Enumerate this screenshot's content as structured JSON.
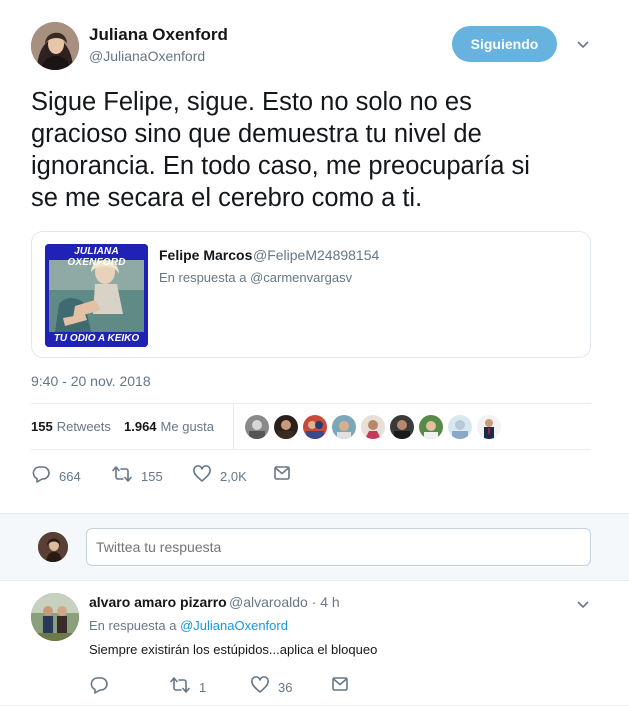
{
  "tweet": {
    "author_name": "Juliana Oxenford",
    "author_handle": "@JulianaOxenford",
    "follow_label": "Siguiendo",
    "text": "Sigue Felipe, sigue. Esto no solo no es\ngracioso sino que demuestra tu nivel de\nignorancia. En todo caso, me preocuparía si\nse me secara el cerebro como a ti.",
    "timestamp": "9:40 - 20 nov. 2018",
    "quote": {
      "image_top_text": "JULIANA OXENFORD",
      "image_bottom_text": "TU ODIO A KEIKO",
      "name": "Felipe Marcos",
      "handle": "@FelipeM24898154",
      "in_reply_prefix": "En respuesta a",
      "in_reply_handle": "@carmenvargasv"
    },
    "stats": {
      "retweets_count": "155",
      "retweets_label": "Retweets",
      "likes_count": "1.964",
      "likes_label": "Me gusta"
    },
    "actions": {
      "replies": "664",
      "retweets": "155",
      "likes": "2,0K"
    }
  },
  "reply_box": {
    "placeholder": "Twittea tu respuesta"
  },
  "reply": {
    "name": "alvaro amaro pizarro",
    "handle": "@alvaroaldo · 4 h",
    "in_reply_prefix": "En respuesta a",
    "in_reply_handle": "@JulianaOxenford",
    "text": "Siempre existirán los estúpidos...aplica el bloqueo",
    "actions": {
      "retweets": "1",
      "likes": "36"
    }
  },
  "colors": {
    "accent": "#1b95e0",
    "follow_button": "#66b3df",
    "muted": "#657786",
    "text": "#14171a"
  }
}
